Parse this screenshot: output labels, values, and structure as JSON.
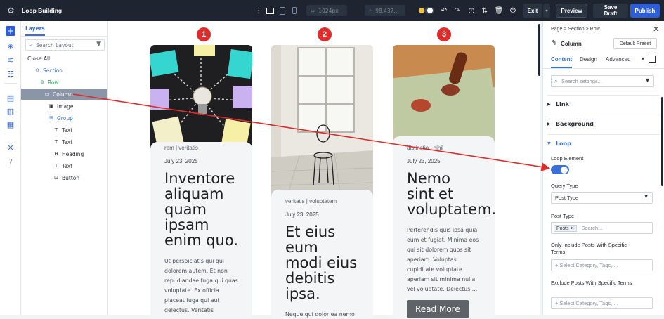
{
  "topbar": {
    "title": "Loop Building",
    "width_field": "1024px",
    "zoom_field": "98,437...",
    "exit_label": "Exit",
    "preview_label": "Preview",
    "save_draft_label": "Save Draft",
    "publish_label": "Publish"
  },
  "layers": {
    "tab_label": "Layers",
    "search_placeholder": "Search Layout",
    "close_all": "Close All",
    "items": [
      {
        "label": "Section",
        "icon": "section-icon"
      },
      {
        "label": "Row",
        "icon": "row-icon"
      },
      {
        "label": "Column",
        "icon": "column-icon"
      },
      {
        "label": "Image",
        "icon": "image-icon"
      },
      {
        "label": "Group",
        "icon": "group-icon"
      },
      {
        "label": "Text",
        "icon": "text-icon"
      },
      {
        "label": "Text",
        "icon": "text-icon"
      },
      {
        "label": "Heading",
        "icon": "heading-icon"
      },
      {
        "label": "Text",
        "icon": "text-icon"
      },
      {
        "label": "Button",
        "icon": "button-icon"
      }
    ]
  },
  "cards": [
    {
      "badge": "1",
      "meta": "rem | veritatis",
      "date": "July 23, 2025",
      "title": "Inventore aliquam quam ipsam enim quo.",
      "excerpt": "Ut perspiciatis qui qui dolorem autem. Et non repudiandae fuga qui quas voluptate. Ex officia placeat fuga qui aut delectus. Veritatis"
    },
    {
      "badge": "2",
      "meta": "veritatis | voluptatem",
      "date": "July 23, 2025",
      "title": "Et eius eum modi eius debitis ipsa.",
      "excerpt": "Neque qui dolor ea nemo"
    },
    {
      "badge": "3",
      "meta": "distinctio | nihil",
      "date": "July 23, 2025",
      "title": "Nemo sint et voluptatem.",
      "excerpt": "Perferendis quis ipsa quia eum et fugiat. Minima eos qui sit dolorem quos sit aperiam. Voluptas cupiditate voluptate aperiam sit minima nulla vel voluptate. Delectus ...",
      "button": "Read More"
    }
  ],
  "settings": {
    "breadcrumb": "Page > Section > Row",
    "element": "Column",
    "preset": "Default Preset",
    "tabs": [
      "Content",
      "Design",
      "Advanced"
    ],
    "search_placeholder": "Search settings...",
    "sections": [
      "Link",
      "Background",
      "Loop"
    ],
    "loop_element_label": "Loop Element",
    "loop_enabled": true,
    "query_type_label": "Query Type",
    "query_type_value": "Post Type",
    "post_type_label": "Post Type",
    "post_type_tag": "Posts",
    "post_type_placeholder": "Search...",
    "only_include_label": "Only Include Posts With Specific Terms",
    "only_include_placeholder": "+ Select Category, Tags, ...",
    "exclude_label": "Exclude Posts With Specific Terms",
    "exclude_placeholder": "+ Select Category, Tags, ..."
  },
  "colors": {
    "accent": "#3a6fd8",
    "badge": "#e02b2b",
    "arrow": "#e02b2b",
    "topbar": "#1e2530"
  }
}
